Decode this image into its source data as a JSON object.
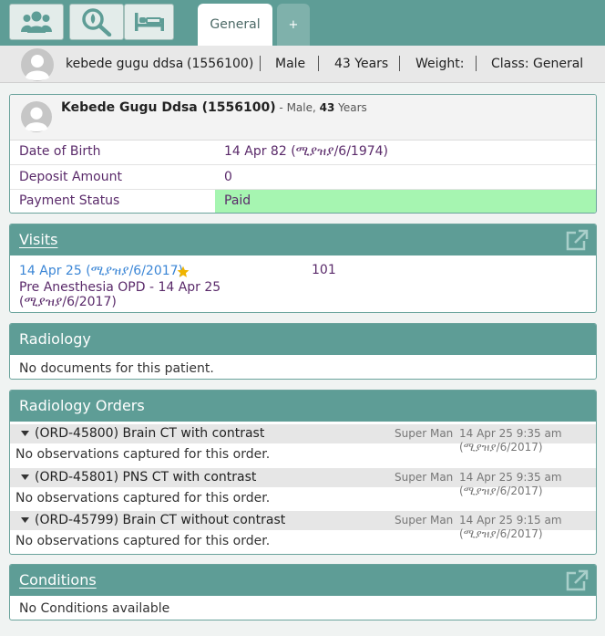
{
  "toolbar": {
    "buttons": [
      {
        "icon": "users-icon"
      },
      {
        "icon": "search-icon"
      },
      {
        "icon": "bed-icon"
      }
    ],
    "tabs": [
      {
        "label": "General",
        "active": true
      },
      {
        "label": "+",
        "active": false
      }
    ]
  },
  "patient_strip": {
    "name": "kebede gugu ddsa",
    "id": "(1556100)",
    "sep1": "|",
    "gender": "Male",
    "sep2": "|",
    "age": "43 Years",
    "sep3": "|",
    "weight": "Weight:",
    "sep4": "|",
    "class": "Class: General"
  },
  "patient_card": {
    "name_id": "Kebede Gugu Ddsa (1556100)",
    "dash_gender": " - Male, ",
    "age_num": "43",
    "age_unit": " Years",
    "rows": [
      {
        "label": "Date of Birth",
        "value": "14 Apr 82",
        "value_alt": "(ሚያዝያ/6/1974)"
      },
      {
        "label": "Deposit Amount",
        "value": "0"
      },
      {
        "label": "Payment Status",
        "value": "Paid"
      }
    ],
    "colors": {
      "paid_bg": "#a6f5b1"
    }
  },
  "visits": {
    "title": "Visits",
    "items": [
      {
        "date": "14 Apr 25",
        "date_alt": "(ሚያዝያ/6/2017)",
        "desc_line1": "Pre Anesthesia OPD - 14 Apr 25",
        "desc_line2": "(ሚያዝያ/6/2017)",
        "room": "101"
      }
    ]
  },
  "radiology": {
    "title": "Radiology",
    "empty": "No documents for this patient."
  },
  "radiology_orders": {
    "title": "Radiology Orders",
    "orders": [
      {
        "title": "(ORD-45800) Brain CT with contrast",
        "provider": "Super Man",
        "datetime": "14 Apr 25 9:35 am",
        "date_alt": "(ሚያዝያ/6/2017)",
        "note": "No observations captured for this order."
      },
      {
        "title": "(ORD-45801) PNS CT with contrast",
        "provider": "Super Man",
        "datetime": "14 Apr 25 9:35 am",
        "date_alt": "(ሚያዝያ/6/2017)",
        "note": "No observations captured for this order."
      },
      {
        "title": "(ORD-45799) Brain CT without contrast",
        "provider": "Super Man",
        "datetime": "14 Apr 25 9:15 am",
        "date_alt": "(ሚያዝያ/6/2017)",
        "note": "No observations captured for this order."
      }
    ]
  },
  "conditions": {
    "title": "Conditions",
    "empty": "No Conditions available"
  },
  "colors": {
    "teal": "#5e9d96",
    "link_blue": "#3b86d6",
    "purple_text": "#5a2a6a",
    "star": "#f0b400"
  }
}
